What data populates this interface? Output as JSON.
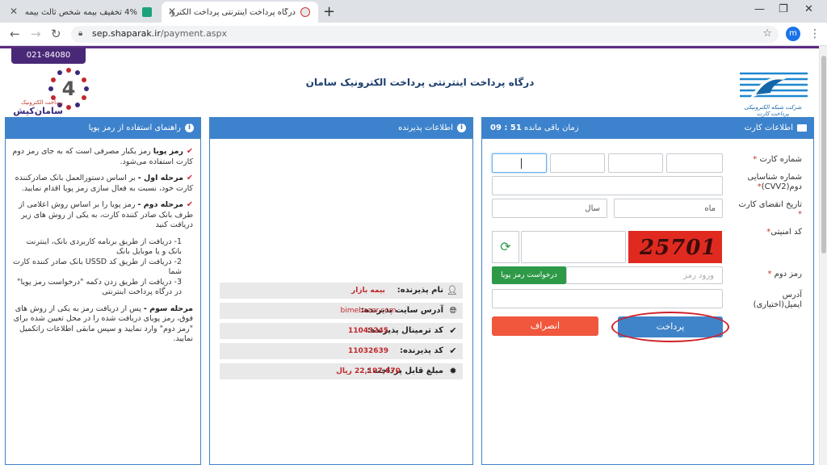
{
  "browser": {
    "tabs": [
      {
        "title": "4% تخفیف بیمه شخص ثالث بیمه",
        "active": false
      },
      {
        "title": "درگاه پرداخت اینترنتی پرداخت الکترونیک",
        "active": true
      }
    ],
    "url_domain": "sep.shaparak.ir",
    "url_path": "/payment.aspx",
    "profile_initial": "m"
  },
  "page": {
    "phone": "021-84080",
    "title": "درگاه پرداخت اینترنتی پرداخت الکترونیک سامان",
    "left_logo": {
      "subtitle": "پرداخت الکترونیک",
      "name": "سامان‌کیش",
      "digit": "4"
    },
    "right_logo_text": "شرکت شبکه الکترونیکی پرداخت کارت"
  },
  "card_panel": {
    "title": "اطلاعات کارت",
    "timer_label": "زمان باقی مانده",
    "timer_value": "51 : 09",
    "labels": {
      "card_number": "شماره کارت",
      "cvv2": "شماره شناسایی دوم(CVV2)",
      "expiry": "تاریخ انقضای کارت",
      "security_code": "کد امنیتی",
      "second_pin": "رمز دوم",
      "email": "آدرس ایمیل(اختیاری)"
    },
    "expiry_month_placeholder": "ماه",
    "expiry_year_placeholder": "سال",
    "captcha_text": "25701",
    "second_pin_placeholder": "ورود رمز",
    "otp_button": "درخواست رمز پویا",
    "pay_button": "پرداخت",
    "cancel_button": "انصراف"
  },
  "merchant_panel": {
    "title": "اطلاعات پذیرنده",
    "rows": [
      {
        "label": "نام پذیرنده:",
        "value": "بیمه بازار"
      },
      {
        "label": "آدرس سایت پذیرنده:",
        "value": "bimebazar.com"
      },
      {
        "label": "کد ترمینال پذیرنده:",
        "value": "11043245"
      },
      {
        "label": "کد پذیرنده:",
        "value": "11032639"
      },
      {
        "label": "مبلغ قابل پرداخت :",
        "value": "22,197,670 ریال"
      }
    ]
  },
  "help_panel": {
    "title": "راهنمای استفاده از رمز پویا",
    "p1_bold": "رمز پویا",
    "p1_text": "رمز یکبار مصرفی است که به جای رمز دوم کارت استفاده می‌شود.",
    "p2_bold": "مرحله اول -",
    "p2_text": "بر اساس دستورالعمل بانک صادرکننده کارت خود، نسبت به فعال سازی رمز پویا اقدام نمایید.",
    "p3_bold": "مرحله دوم -",
    "p3_text": "رمز پویا را بر اساس روش اعلامی از طرف بانک صادر کننده کارت، به یکی از روش های زیر دریافت کنید",
    "methods": [
      "1- دریافت از طریق برنامه کاربردی بانک، اینترنت بانک و یا موبایل بانک",
      "2- دریافت از طریق کد USSD بانک صادر کننده کارت شما",
      "3- دریافت از طریق زدن دکمه \"درخواست رمز پویا\" در درگاه پرداخت اینترنتی"
    ],
    "p4_bold": "مرحله سوم -",
    "p4_text": "پس از دریافت رمز به یکی از روش های فوق، رمز پویای دریافت شده را در محل تعیین شده برای \"رمز دوم\" وارد نمایید و سپس مابقی اطلاعات راتکمیل نمایید."
  }
}
